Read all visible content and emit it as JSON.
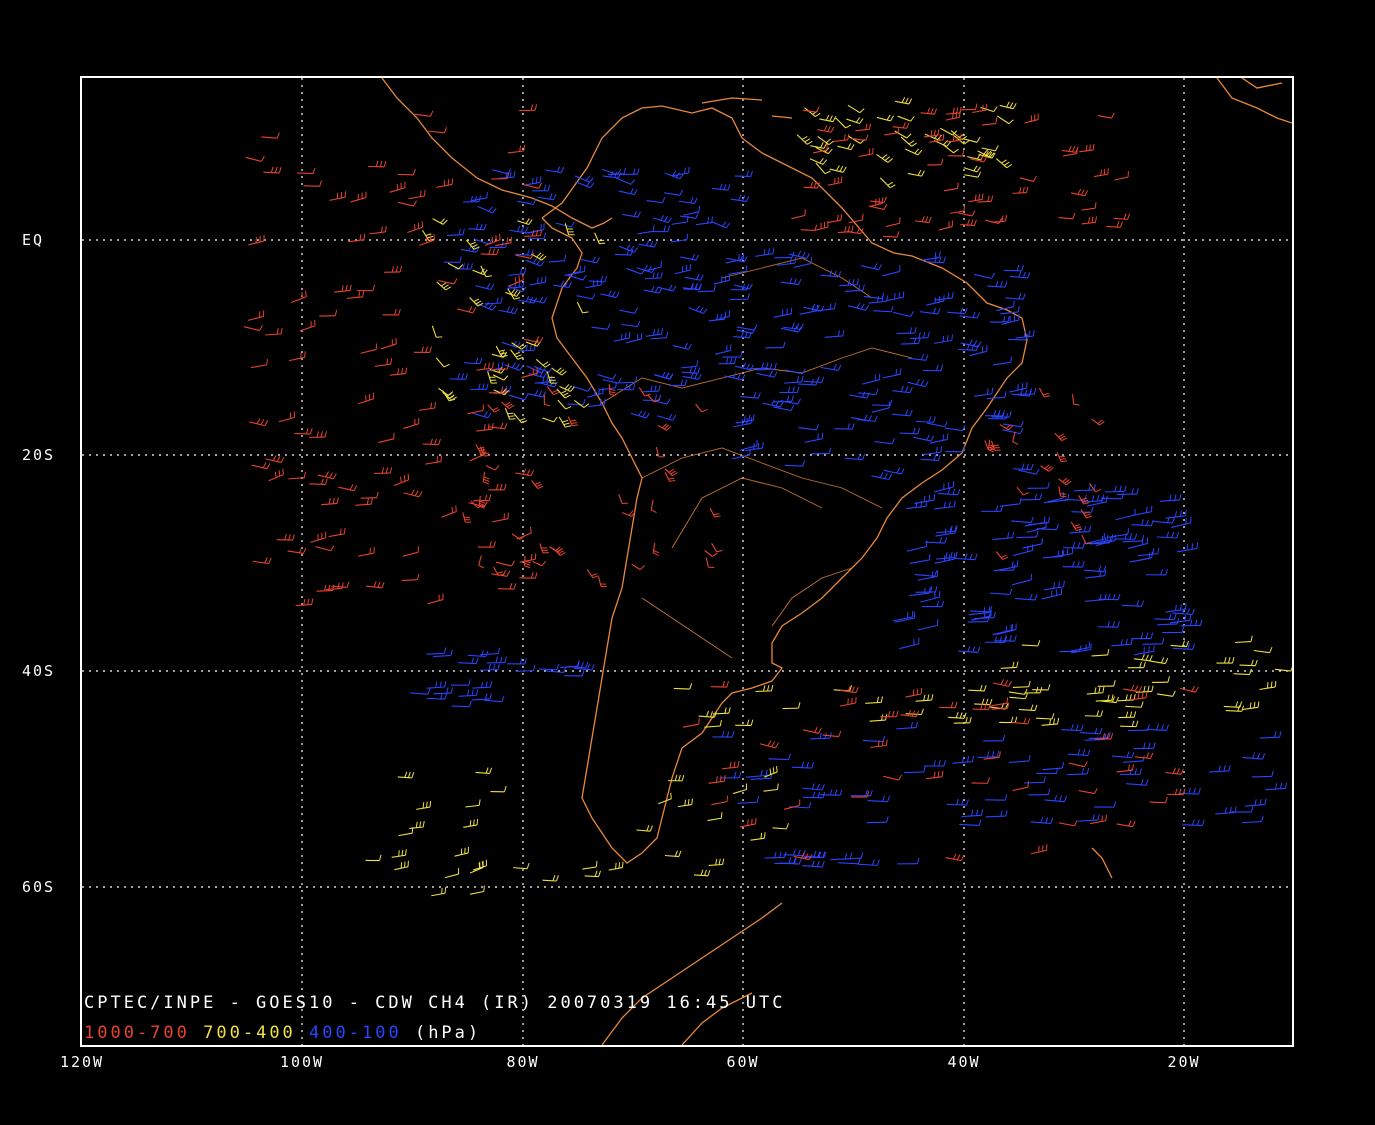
{
  "colors": {
    "background": "#000000",
    "frame": "#ffffff",
    "grid": "#ffffff",
    "coastline": "#e8893a",
    "low_level": "#e8432e",
    "mid_level": "#f0e040",
    "high_level": "#2a45ff"
  },
  "axes": {
    "lon_ticks": [
      "120W",
      "100W",
      "80W",
      "60W",
      "40W",
      "20W"
    ],
    "lat_ticks": [
      "EQ",
      "20S",
      "40S",
      "60S"
    ]
  },
  "caption": "CPTEC/INPE - GOES10 - CDW CH4 (IR) 20070319 16:45 UTC",
  "legend": {
    "low": "1000-700",
    "mid": "700-400",
    "high": "400-100",
    "unit": "(hPa)"
  }
}
